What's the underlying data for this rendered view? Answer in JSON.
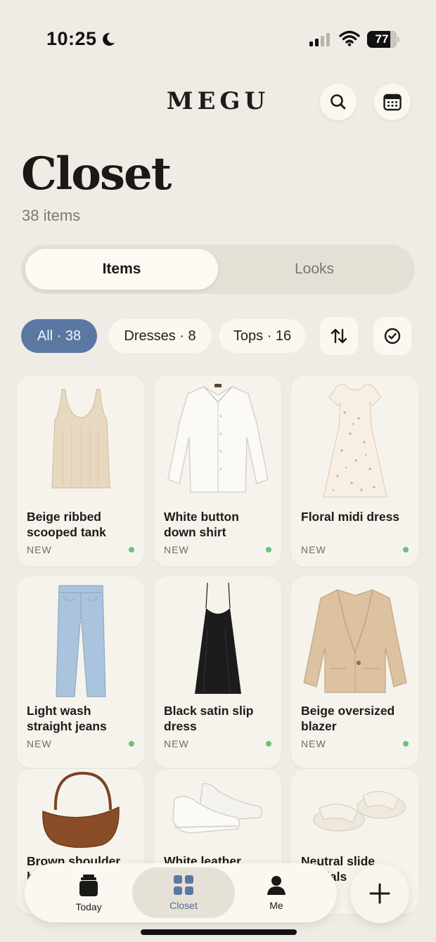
{
  "status_bar": {
    "time": "10:25",
    "battery": "77"
  },
  "header": {
    "brand": "MEGU",
    "search_icon": "search-icon",
    "calendar_icon": "calendar-icon"
  },
  "page": {
    "title": "Closet",
    "count": "38 items"
  },
  "segmented": {
    "items": "Items",
    "looks": "Looks",
    "selected": "Items"
  },
  "filters": {
    "all": "All · 38",
    "dresses": "Dresses · 8",
    "tops": "Tops · 16",
    "sort_icon": "sort-arrows-icon",
    "select_icon": "check-circle-icon"
  },
  "items": [
    {
      "name": "Beige ribbed scooped tank",
      "tag": "NEW",
      "icon": "tank-top-icon"
    },
    {
      "name": "White button down shirt",
      "tag": "NEW",
      "icon": "shirt-icon"
    },
    {
      "name": "Floral midi dress",
      "tag": "NEW",
      "icon": "dress-icon"
    },
    {
      "name": "Light wash straight jeans",
      "tag": "NEW",
      "icon": "jeans-icon"
    },
    {
      "name": "Black satin slip dress",
      "tag": "NEW",
      "icon": "slip-dress-icon"
    },
    {
      "name": "Beige oversized blazer",
      "tag": "NEW",
      "icon": "blazer-icon"
    },
    {
      "name": "Brown shoulder bag",
      "icon": "handbag-icon"
    },
    {
      "name": "White leather sneakers",
      "icon": "sneakers-icon"
    },
    {
      "name": "Neutral slide sandals",
      "icon": "sandals-icon"
    }
  ],
  "nav": {
    "today": "Today",
    "closet": "Closet",
    "me": "Me",
    "active": "Closet"
  },
  "colors": {
    "background": "#efebe5",
    "accent": "#5a78a2",
    "new_dot": "#6cc27a"
  }
}
